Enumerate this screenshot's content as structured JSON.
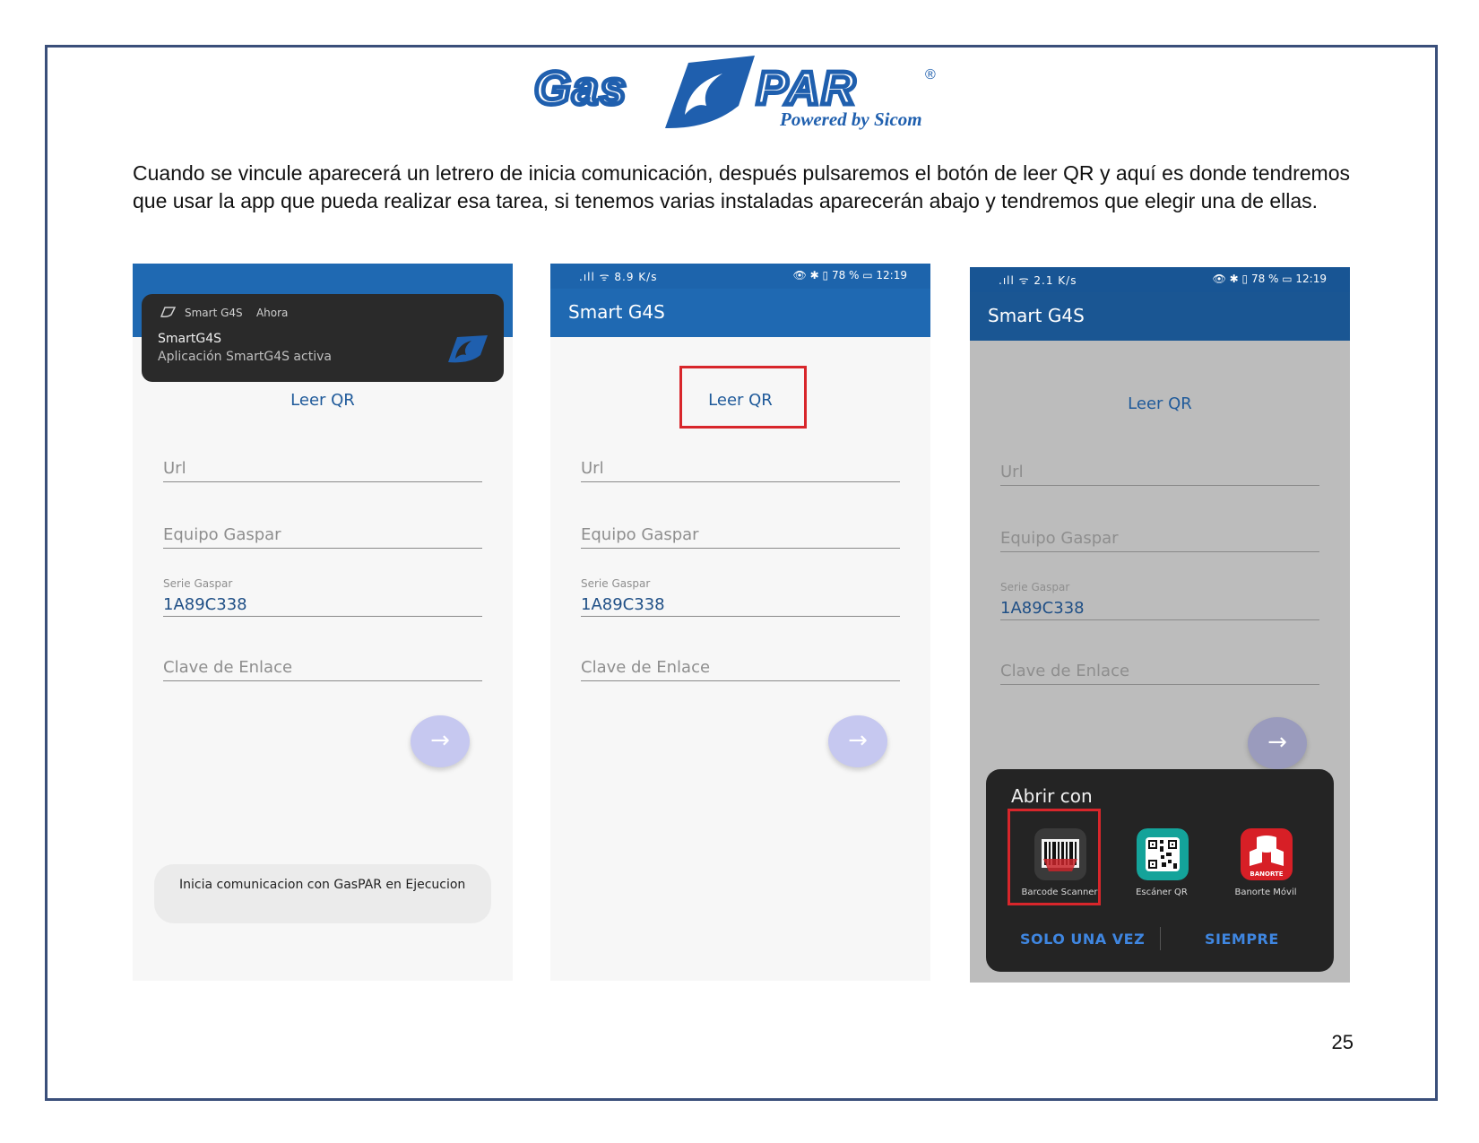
{
  "logo": {
    "wordmark_left": "Gas",
    "wordmark_right": "PAR",
    "registered": "®",
    "tagline": "Powered by Sicom",
    "brand_color": "#1f5fae"
  },
  "intro_text": "Cuando se vincule aparecerá un letrero de inicia comunicación, después pulsaremos el botón de leer QR y aquí es donde tendremos que usar la app que pueda realizar esa tarea, si tenemos varias instaladas aparecerán abajo y tendremos que elegir una de ellas.",
  "page_number": "25",
  "screens": [
    {
      "notification": {
        "app_name": "Smart G4S",
        "time": "Ahora",
        "title": "SmartG4S",
        "text": "Aplicación SmartG4S activa"
      },
      "qr_button": "Leer QR",
      "fields": {
        "url": "Url",
        "equipo": "Equipo Gaspar",
        "serie_label": "Serie Gaspar",
        "serie_value": "1A89C338",
        "clave": "Clave de Enlace"
      },
      "fab_icon": "arrow-right-icon",
      "toast": "Inicia comunicacion con GasPAR en Ejecucion"
    },
    {
      "status": {
        "left": ".ıll ᯤ 8.9 K/s",
        "right": "👁 ✱ ▯ 78 % ▭ 12:19"
      },
      "app_title": "Smart G4S",
      "qr_button": "Leer QR",
      "fields": {
        "url": "Url",
        "equipo": "Equipo Gaspar",
        "serie_label": "Serie Gaspar",
        "serie_value": "1A89C338",
        "clave": "Clave de Enlace"
      },
      "fab_icon": "arrow-right-icon"
    },
    {
      "status": {
        "left": ".ıll ᯤ 2.1 K/s",
        "right": "👁 ✱ ▯ 78 % ▭ 12:19"
      },
      "app_title": "Smart G4S",
      "qr_button": "Leer QR",
      "fields": {
        "url": "Url",
        "equipo": "Equipo Gaspar",
        "serie_label": "Serie Gaspar",
        "serie_value": "1A89C338",
        "clave": "Clave de Enlace"
      },
      "fab_icon": "arrow-right-icon",
      "open_with": {
        "title": "Abrir con",
        "apps": [
          {
            "label": "Barcode Scanner",
            "icon": "barcode-icon"
          },
          {
            "label": "Escáner QR",
            "icon": "qr-code-icon"
          },
          {
            "label": "Banorte Móvil",
            "icon": "banorte-icon",
            "icon_text": "BANORTE"
          }
        ],
        "once": "SOLO UNA VEZ",
        "always": "SIEMPRE"
      }
    }
  ],
  "colors": {
    "app_bar": "#1f69b2",
    "highlight": "#d8262b",
    "link": "#1f5a9a",
    "dialog_action": "#3f86e0"
  }
}
